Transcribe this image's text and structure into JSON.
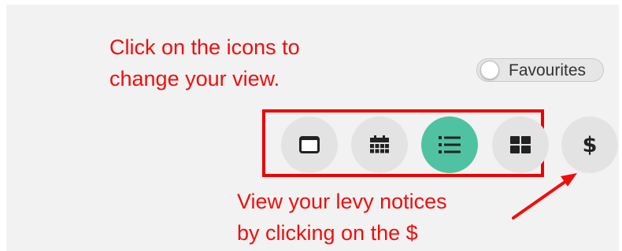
{
  "instructions": {
    "top_line_1": "Click on the icons to",
    "top_line_2": "change your view.",
    "bottom_line_1": "View your levy notices",
    "bottom_line_2": "by clicking on the $"
  },
  "favourites_toggle": {
    "label": "Favourites",
    "checked": false
  },
  "view_buttons": [
    {
      "icon": "card-view-icon",
      "active": false
    },
    {
      "icon": "calendar-view-icon",
      "active": false
    },
    {
      "icon": "list-view-icon",
      "active": true
    },
    {
      "icon": "grid-view-icon",
      "active": false
    }
  ],
  "levy_button": {
    "glyph": "$",
    "icon": "dollar-icon"
  },
  "colors": {
    "annotation_red": "#f20d0d",
    "active_green": "#4fc3a1",
    "button_grey": "#e3e3e3",
    "panel_background": "#f2f2f2"
  }
}
